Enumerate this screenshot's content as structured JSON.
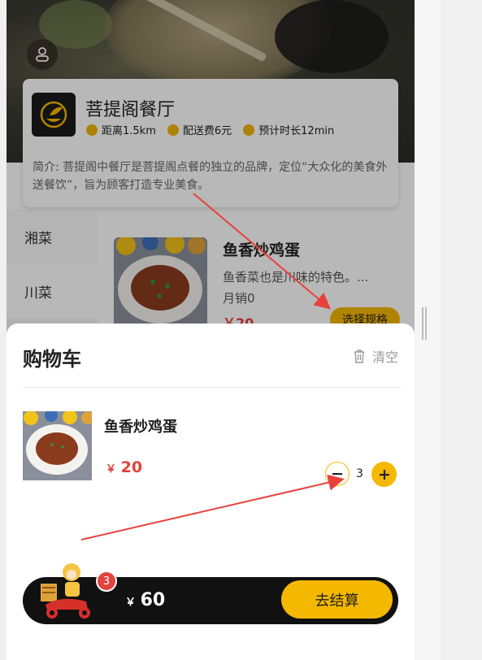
{
  "restaurant": {
    "name": "菩提阁餐厅",
    "distance": "距离1.5km",
    "delivery_fee": "配送费6元",
    "eta": "预计时长12min",
    "intro": "简介: 菩提阁中餐厅是菩提阁点餐的独立的品牌，定位“大众化的美食外送餐饮”，旨为顾客打造专业美食。"
  },
  "categories": [
    {
      "label": "湘菜"
    },
    {
      "label": "川菜"
    }
  ],
  "dish": {
    "title": "鱼香炒鸡蛋",
    "desc": "鱼香菜也是川味的特色。...",
    "sales": "月销0",
    "price": "￥20",
    "spec_button": "选择规格"
  },
  "cart": {
    "title": "购物车",
    "clear_label": "清空",
    "item": {
      "name": "鱼香炒鸡蛋",
      "price_symbol": "￥",
      "price": "20",
      "quantity": "3"
    },
    "badge_count": "3",
    "total_symbol": "￥",
    "total": "60",
    "checkout_label": "去结算"
  },
  "colors": {
    "accent": "#f5b800",
    "price": "#e3413a",
    "annotation_arrow": "#e8413c"
  }
}
